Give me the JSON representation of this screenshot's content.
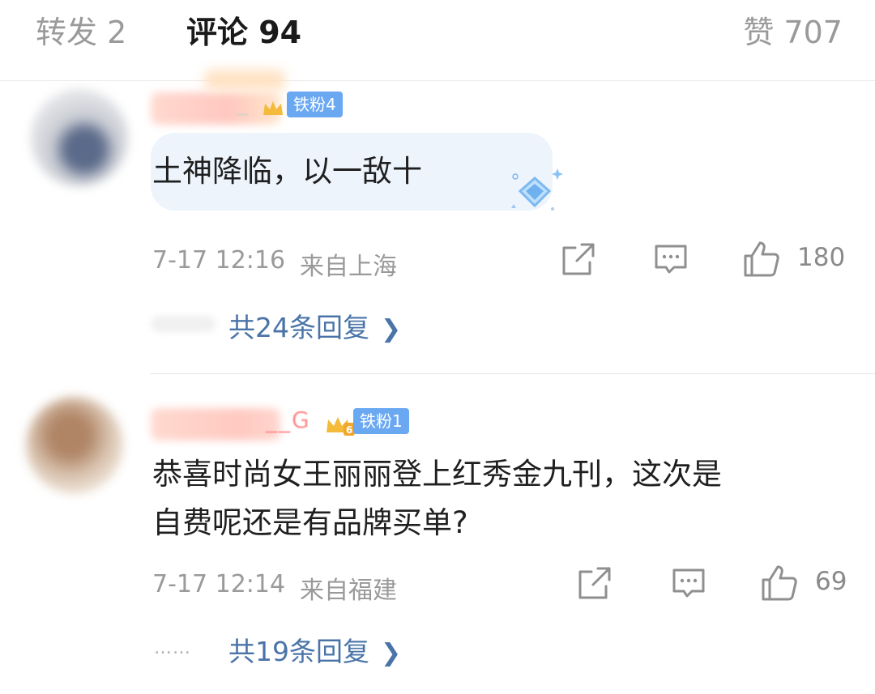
{
  "tabs": {
    "repost": "转发 2",
    "comment": "评论 94",
    "like": "赞 707"
  },
  "comments": [
    {
      "username_visible": "_",
      "fan_badge": "铁粉4",
      "text": "土神降临，以一敌十",
      "time": "7-17 12:16",
      "location": "来自上海",
      "likes": "180",
      "replies": "共24条回复"
    },
    {
      "username_visible": "__G",
      "crown_level": "6",
      "fan_badge": "铁粉1",
      "text_lines": [
        "恭喜时尚女王丽丽登上红秀金九刊，这次是",
        "自费呢还是有品牌买单?"
      ],
      "time": "7-17 12:14",
      "location": "来自福建",
      "likes": "69",
      "replies": "共19条回复"
    }
  ],
  "icons": {
    "share": "share-icon",
    "reply": "comment-icon",
    "like": "thumbs-up-icon",
    "chevron": "chevron-right-icon",
    "decoration": "diamond-decoration-icon",
    "crown": "crown-icon"
  },
  "colors": {
    "link": "#4a74a8",
    "badge": "#6aa8f2",
    "muted": "#9a9a9a",
    "bubble": "#eef4fc"
  },
  "placeholders": {
    "more_dots": "……"
  }
}
